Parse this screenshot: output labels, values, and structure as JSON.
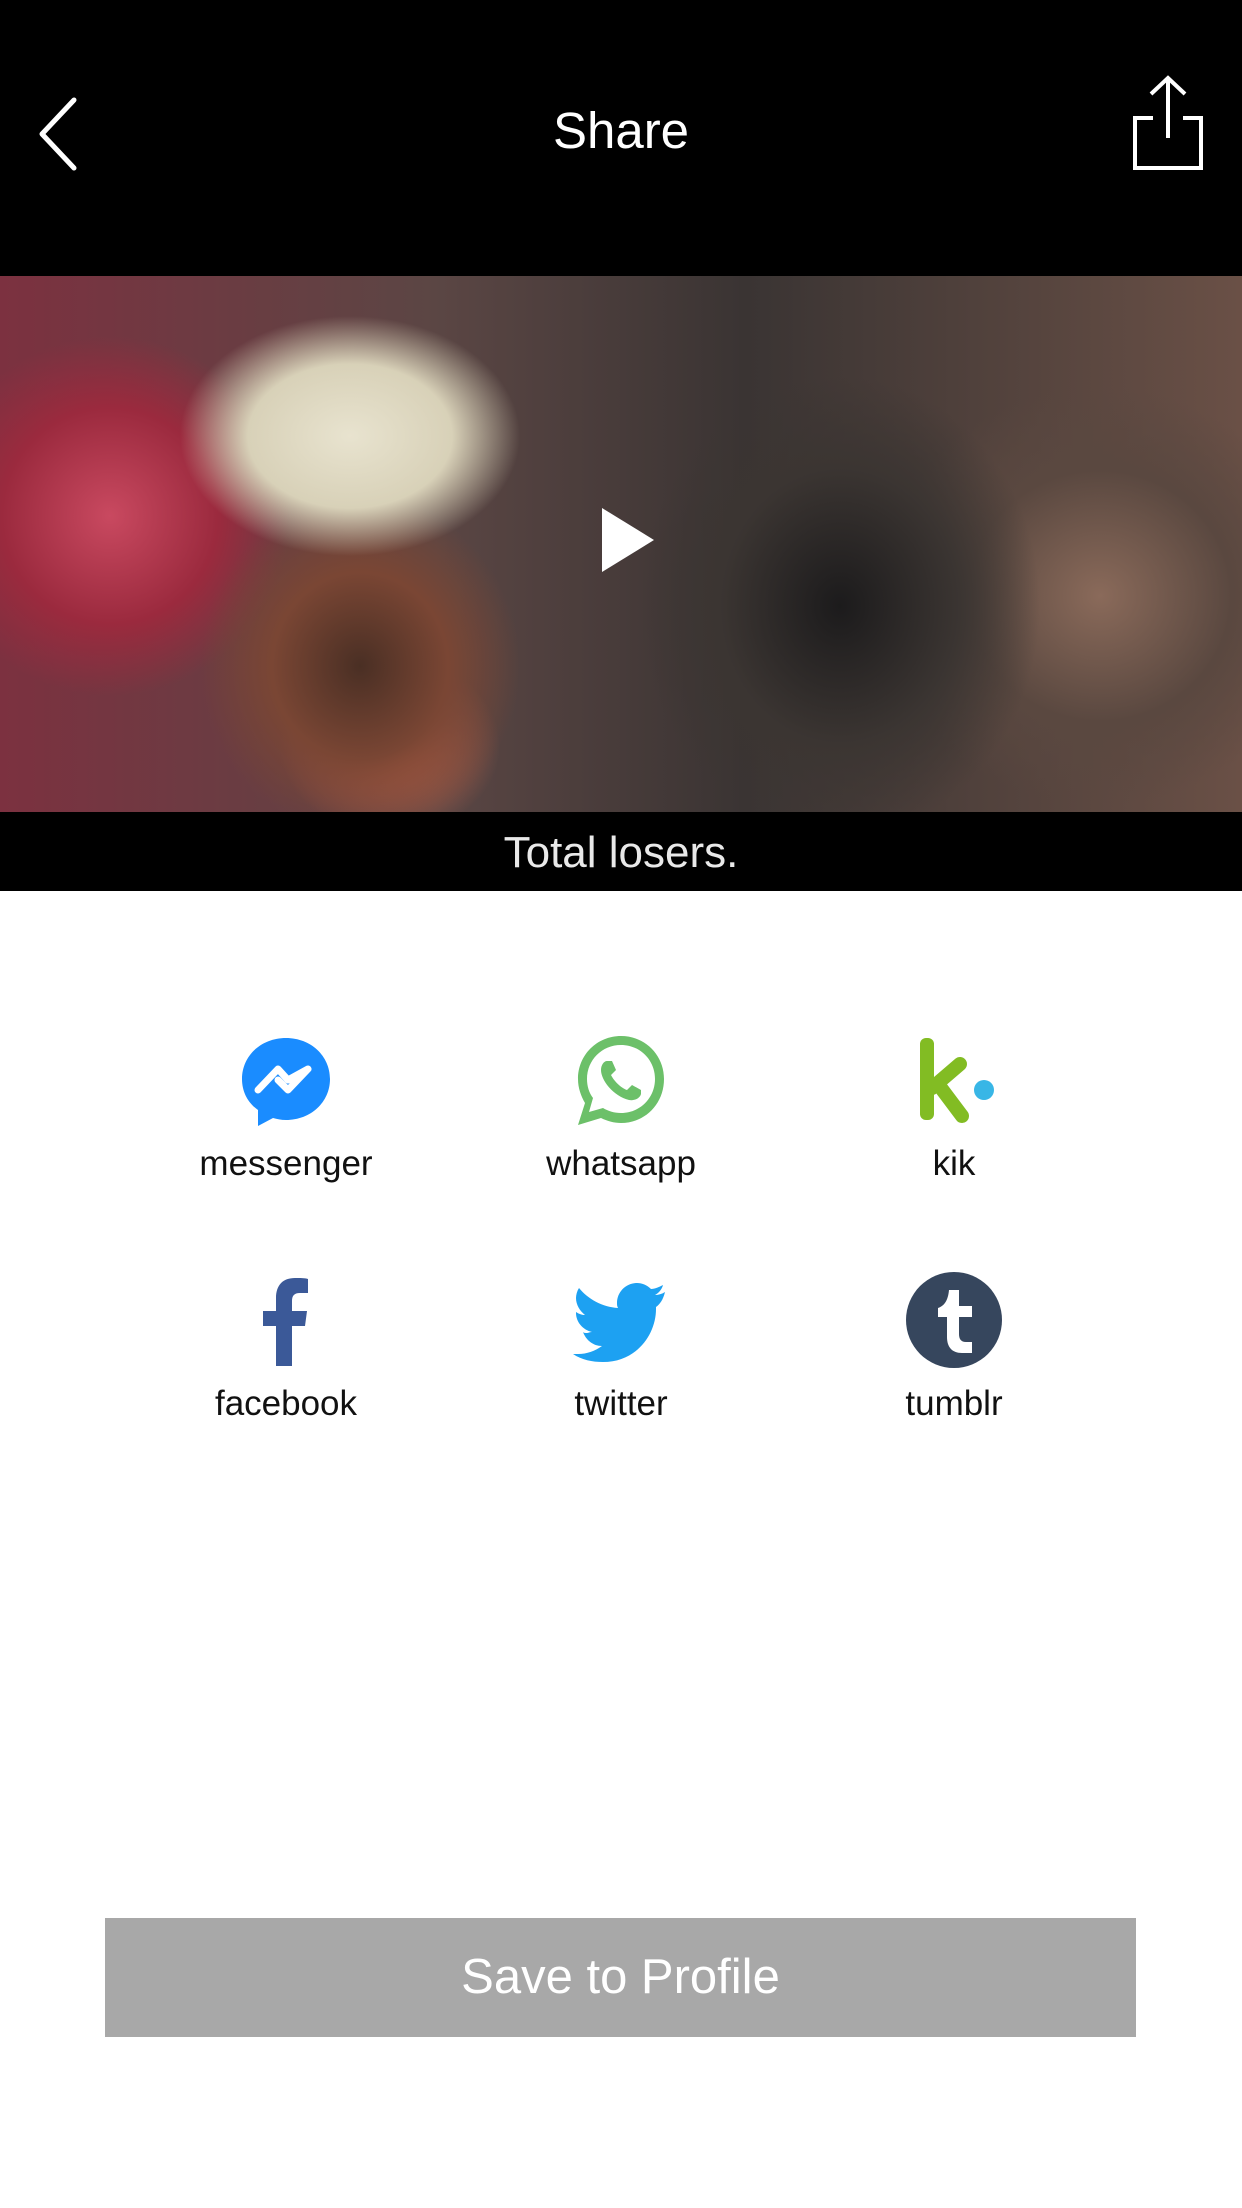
{
  "header": {
    "title": "Share"
  },
  "video": {
    "subtitle": "Total losers."
  },
  "share_options": [
    {
      "label": "messenger",
      "icon": "messenger-icon",
      "color": "#1A8CFF"
    },
    {
      "label": "whatsapp",
      "icon": "whatsapp-icon",
      "color": "#6CC069"
    },
    {
      "label": "kik",
      "icon": "kik-icon",
      "color": "#82BC23"
    },
    {
      "label": "facebook",
      "icon": "facebook-icon",
      "color": "#3B5998"
    },
    {
      "label": "twitter",
      "icon": "twitter-icon",
      "color": "#1DA1F2"
    },
    {
      "label": "tumblr",
      "icon": "tumblr-icon",
      "color": "#36465D"
    }
  ],
  "actions": {
    "save_label": "Save to Profile"
  },
  "colors": {
    "header_bg": "#000000",
    "save_button_bg": "#A8A8A8"
  }
}
